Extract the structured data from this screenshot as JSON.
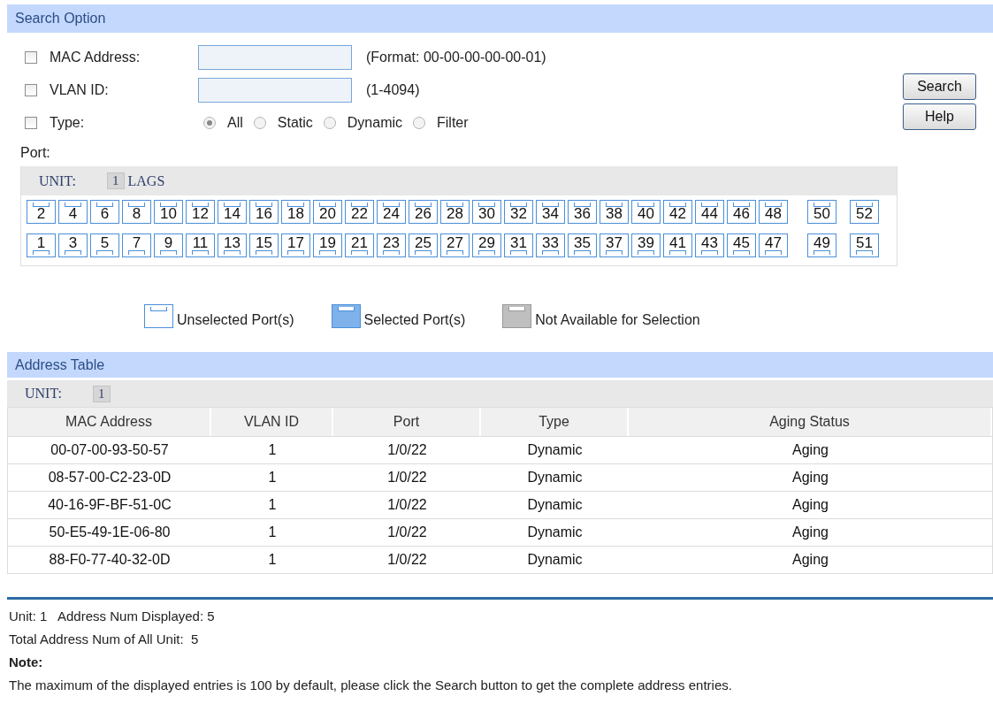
{
  "search_option": {
    "title": "Search Option",
    "filters": [
      {
        "kind": "text",
        "label": "MAC Address:",
        "checked": false,
        "hint": "(Format: 00-00-00-00-00-01)"
      },
      {
        "kind": "text",
        "label": "VLAN ID:",
        "checked": false,
        "hint": "(1-4094)"
      },
      {
        "kind": "radio",
        "label": "Type:",
        "checked": false,
        "options": [
          {
            "label": "All",
            "selected": true
          },
          {
            "label": "Static",
            "selected": false
          },
          {
            "label": "Dynamic",
            "selected": false
          },
          {
            "label": "Filter",
            "selected": false
          }
        ]
      }
    ],
    "buttons": [
      "Search",
      "Help"
    ],
    "port_label": "Port:",
    "port_panel": {
      "unit_label": "UNIT:",
      "unit": "1",
      "lags": "LAGS",
      "rows": [
        {
          "kind": "top",
          "main": [
            {
              "label": "2",
              "selected": false
            },
            {
              "label": "4",
              "selected": false
            },
            {
              "label": "6",
              "selected": false
            },
            {
              "label": "8",
              "selected": false
            },
            {
              "label": "10",
              "selected": false
            },
            {
              "label": "12",
              "selected": false
            },
            {
              "label": "14",
              "selected": false
            },
            {
              "label": "16",
              "selected": false
            },
            {
              "label": "18",
              "selected": false
            },
            {
              "label": "20",
              "selected": false
            },
            {
              "label": "22",
              "selected": false
            },
            {
              "label": "24",
              "selected": false
            },
            {
              "label": "26",
              "selected": false
            },
            {
              "label": "28",
              "selected": false
            },
            {
              "label": "30",
              "selected": false
            },
            {
              "label": "32",
              "selected": false
            },
            {
              "label": "34",
              "selected": false
            },
            {
              "label": "36",
              "selected": false
            },
            {
              "label": "38",
              "selected": false
            },
            {
              "label": "40",
              "selected": false
            },
            {
              "label": "42",
              "selected": false
            },
            {
              "label": "44",
              "selected": false
            },
            {
              "label": "46",
              "selected": false
            },
            {
              "label": "48",
              "selected": false
            }
          ],
          "extra": [
            {
              "label": "50",
              "selected": false
            },
            {
              "label": "52",
              "selected": false
            }
          ]
        },
        {
          "kind": "bottom",
          "main": [
            {
              "label": "1",
              "selected": false
            },
            {
              "label": "3",
              "selected": false
            },
            {
              "label": "5",
              "selected": false
            },
            {
              "label": "7",
              "selected": false
            },
            {
              "label": "9",
              "selected": false
            },
            {
              "label": "11",
              "selected": false
            },
            {
              "label": "13",
              "selected": false
            },
            {
              "label": "15",
              "selected": false
            },
            {
              "label": "17",
              "selected": false
            },
            {
              "label": "19",
              "selected": false
            },
            {
              "label": "21",
              "selected": false
            },
            {
              "label": "23",
              "selected": false
            },
            {
              "label": "25",
              "selected": false
            },
            {
              "label": "27",
              "selected": false
            },
            {
              "label": "29",
              "selected": false
            },
            {
              "label": "31",
              "selected": false
            },
            {
              "label": "33",
              "selected": false
            },
            {
              "label": "35",
              "selected": false
            },
            {
              "label": "37",
              "selected": false
            },
            {
              "label": "39",
              "selected": false
            },
            {
              "label": "41",
              "selected": false
            },
            {
              "label": "43",
              "selected": false
            },
            {
              "label": "45",
              "selected": false
            },
            {
              "label": "47",
              "selected": false
            }
          ],
          "extra": [
            {
              "label": "49",
              "selected": false
            },
            {
              "label": "51",
              "selected": false
            }
          ]
        }
      ]
    },
    "legend": [
      {
        "kind": "unselected",
        "label": "Unselected Port(s)"
      },
      {
        "kind": "selected",
        "label": "Selected Port(s)"
      },
      {
        "kind": "unavailable",
        "label": "Not Available for Selection"
      }
    ]
  },
  "address_table": {
    "title": "Address Table",
    "unit_label": "UNIT:",
    "unit": "1",
    "columns": [
      "MAC Address",
      "VLAN ID",
      "Port",
      "Type",
      "Aging Status"
    ],
    "rows": [
      [
        "00-07-00-93-50-57",
        "1",
        "1/0/22",
        "Dynamic",
        "Aging"
      ],
      [
        "08-57-00-C2-23-0D",
        "1",
        "1/0/22",
        "Dynamic",
        "Aging"
      ],
      [
        "40-16-9F-BF-51-0C",
        "1",
        "1/0/22",
        "Dynamic",
        "Aging"
      ],
      [
        "50-E5-49-1E-06-80",
        "1",
        "1/0/22",
        "Dynamic",
        "Aging"
      ],
      [
        "88-F0-77-40-32-0D",
        "1",
        "1/0/22",
        "Dynamic",
        "Aging"
      ]
    ]
  },
  "summary": [
    "Unit: 1   Address Num Displayed: 5",
    "Total Address Num of All Unit:  5"
  ],
  "note": {
    "title": "Note:",
    "text": "The maximum of the displayed entries is 100 by default, please click the Search button to get the complete address entries."
  }
}
